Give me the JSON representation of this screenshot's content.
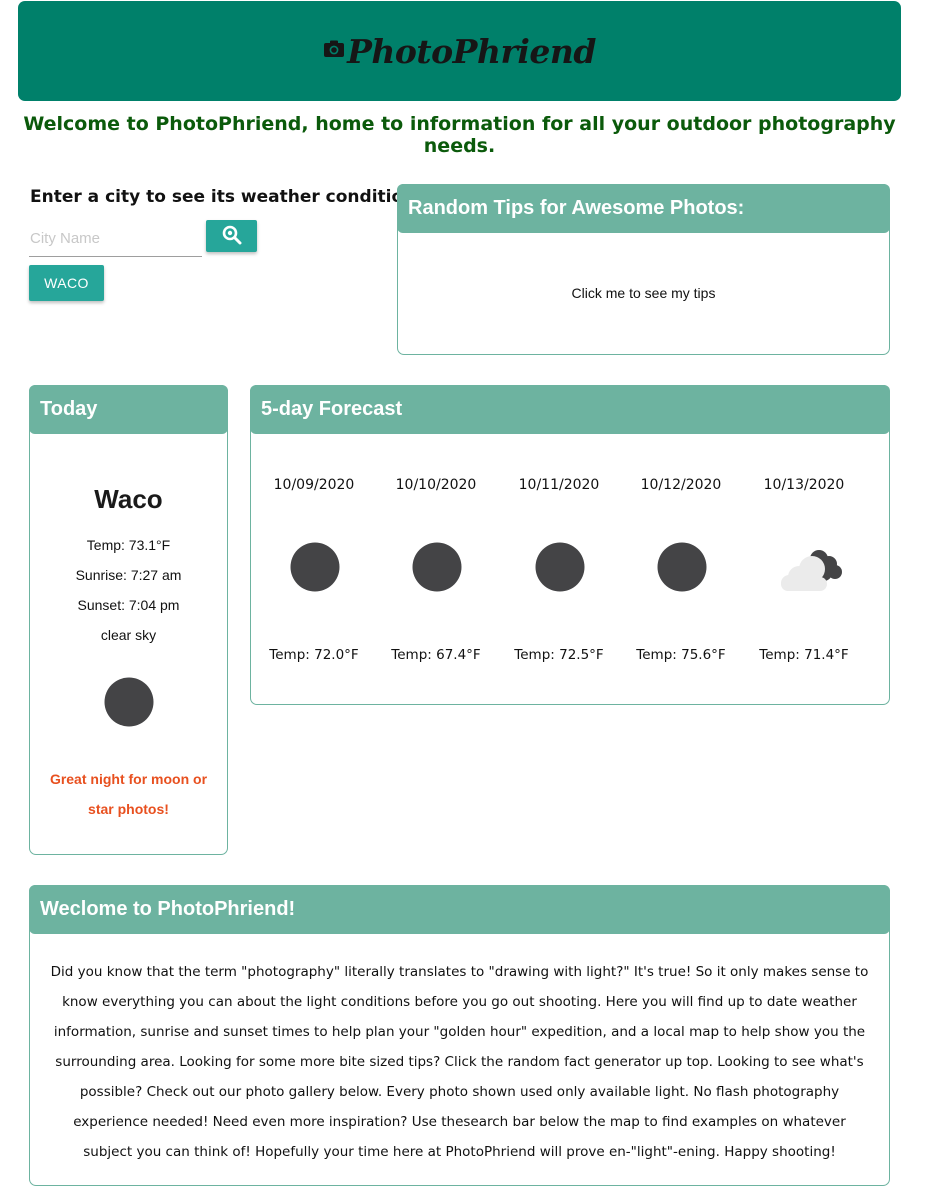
{
  "header": {
    "brand_name": "PhotoPhriend",
    "logo_icon": "camera-icon",
    "background_color": "#00806a"
  },
  "welcome_text": "Welcome to PhotoPhriend, home to information for all your outdoor photography needs.",
  "search": {
    "heading": "Enter a city to see its weather conditions",
    "placeholder": "City Name",
    "value": "",
    "search_icon": "search-icon",
    "history": [
      "WACO"
    ]
  },
  "tips": {
    "title": "Random Tips for Awesome Photos:",
    "prompt": "Click me to see my tips"
  },
  "today": {
    "title": "Today",
    "city": "Waco",
    "temp": "Temp: 73.1°F",
    "sunrise": "Sunrise: 7:27 am",
    "sunset": "Sunset: 7:04 pm",
    "description": "clear sky",
    "icon": "moon-icon",
    "message": "Great night for moon or star photos!"
  },
  "forecast": {
    "title": "5-day Forecast",
    "days": [
      {
        "date": "10/09/2020",
        "icon": "moon-icon",
        "temp": "Temp: 72.0°F"
      },
      {
        "date": "10/10/2020",
        "icon": "moon-icon",
        "temp": "Temp: 67.4°F"
      },
      {
        "date": "10/11/2020",
        "icon": "moon-icon",
        "temp": "Temp: 72.5°F"
      },
      {
        "date": "10/12/2020",
        "icon": "moon-icon",
        "temp": "Temp: 75.6°F"
      },
      {
        "date": "10/13/2020",
        "icon": "cloudy-night-icon",
        "temp": "Temp: 71.4°F"
      }
    ]
  },
  "about": {
    "title": "Weclome to PhotoPhriend!",
    "body": "Did you know that the term \"photography\" literally translates to \"drawing with light?\" It's true! So it only makes sense to know everything you can about the light conditions before you go out shooting. Here you will find up to date weather information, sunrise and sunset times to help plan your \"golden hour\" expedition, and a local map to help show you the surrounding area. Looking for some more bite sized tips? Click the random fact generator up top. Looking to see what's possible? Check out our photo gallery below. Every photo shown used only available light. No flash photography experience needed! Need even more inspiration? Use thesearch bar below the map to find examples on whatever subject you can think of! Hopefully your time here at PhotoPhriend will prove en-\"light\"-ening. Happy shooting!"
  },
  "colors": {
    "accent": "#26a69a",
    "card_header": "#6db3a0",
    "welcome_text": "#0b5a0b",
    "message_text": "#e8501f",
    "moon": "#444446"
  }
}
